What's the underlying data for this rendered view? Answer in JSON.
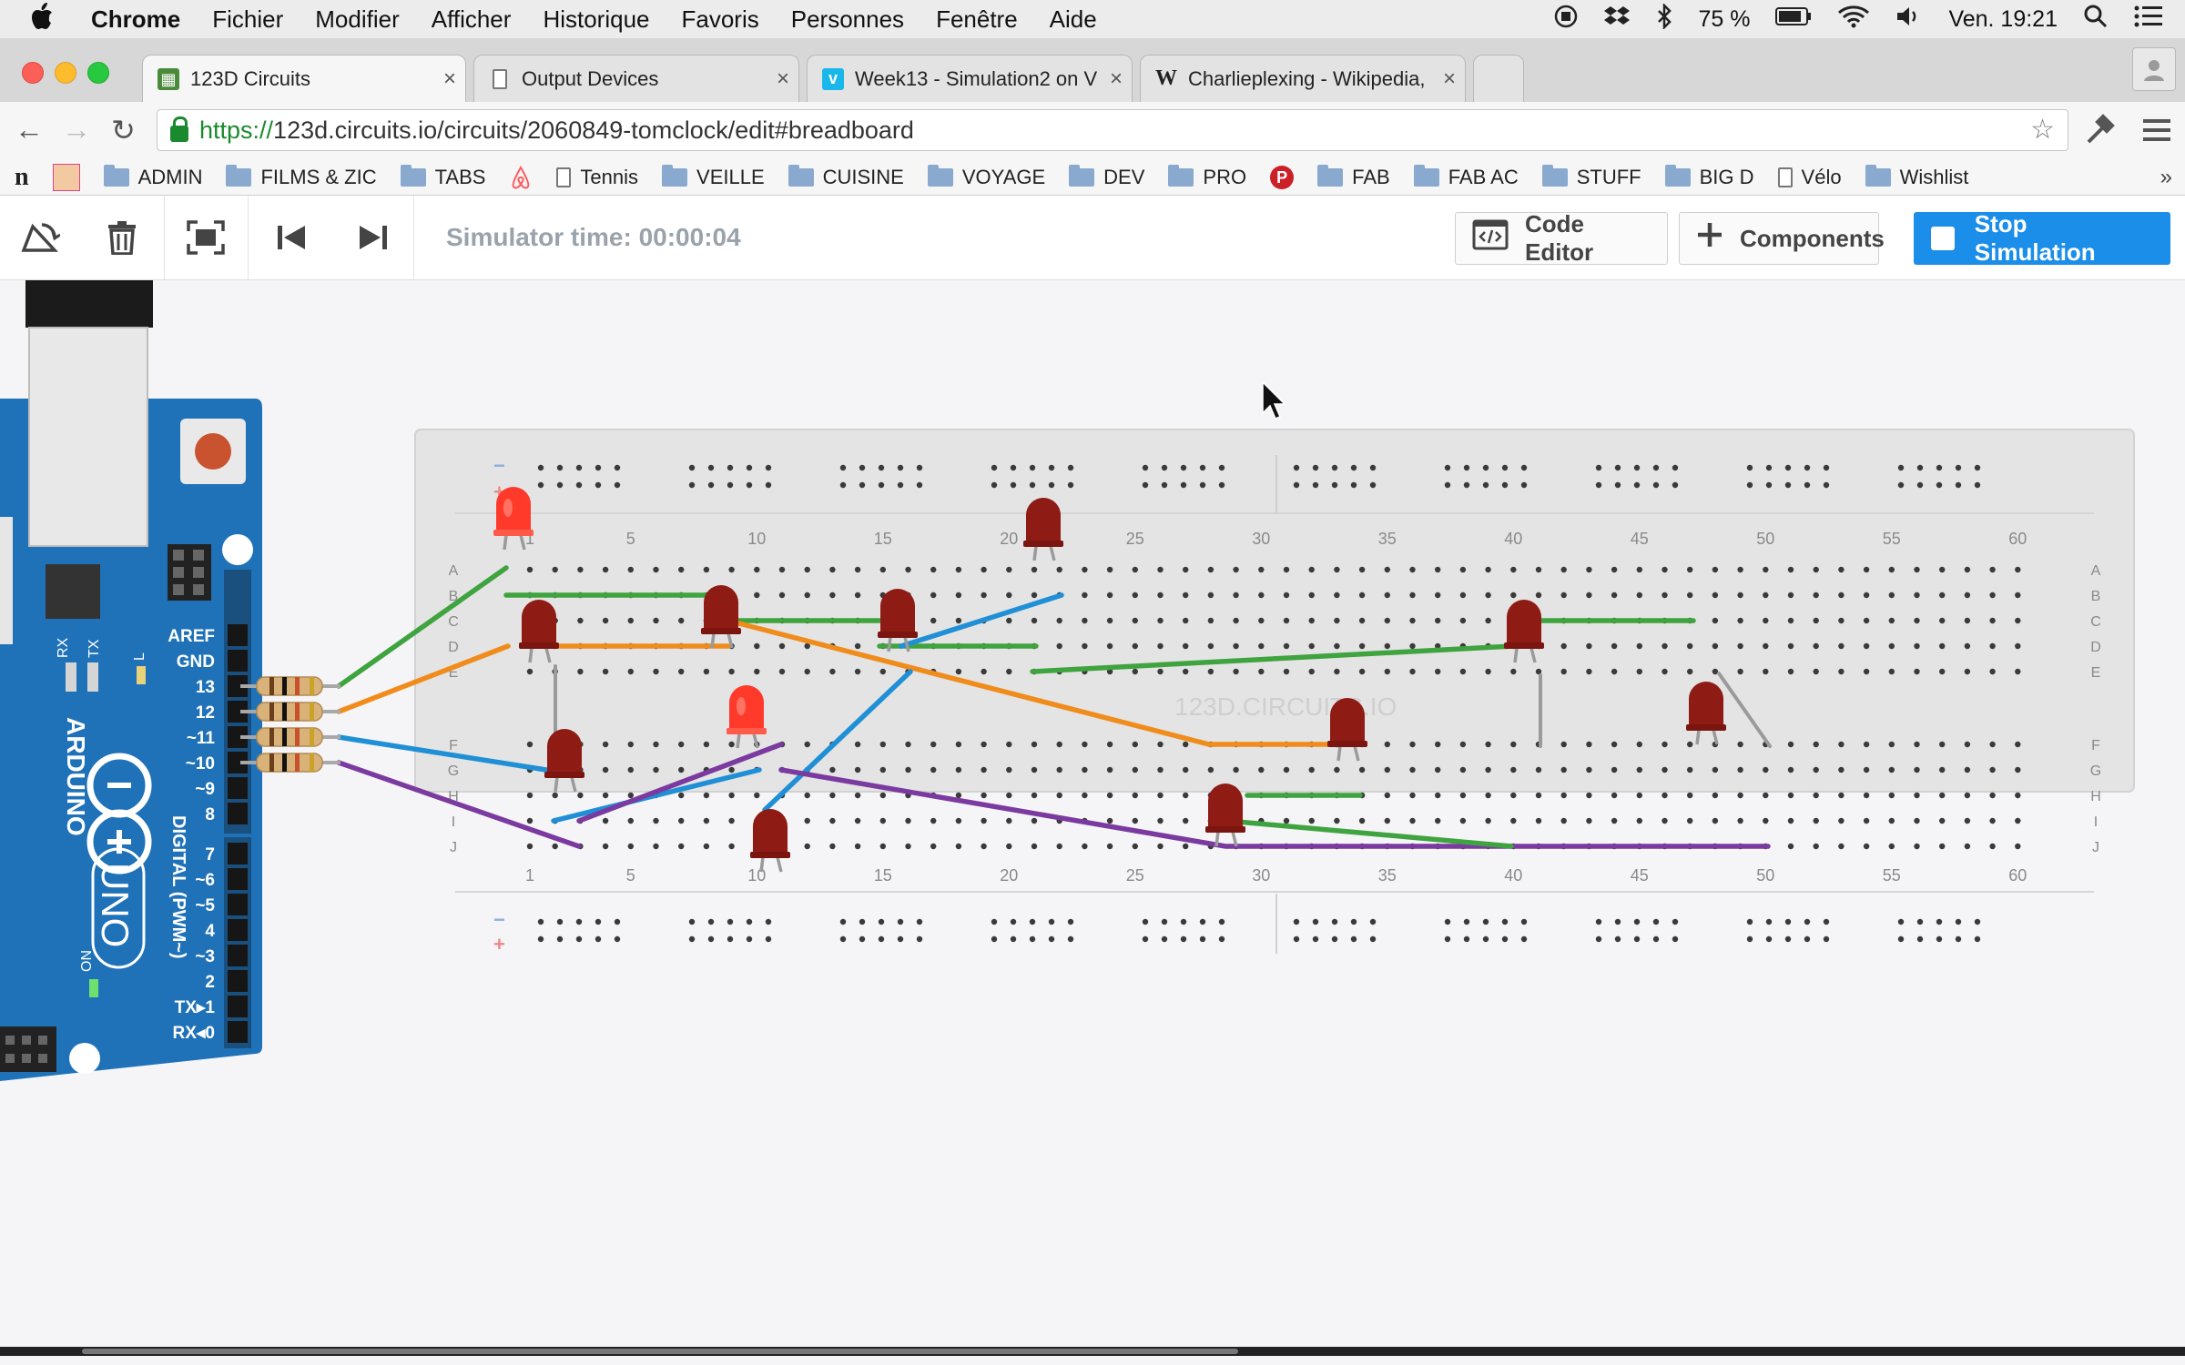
{
  "menubar": {
    "app": "Chrome",
    "items": [
      "Fichier",
      "Modifier",
      "Afficher",
      "Historique",
      "Favoris",
      "Personnes",
      "Fenêtre",
      "Aide"
    ],
    "battery": "75 %",
    "clock": "Ven. 19:21"
  },
  "tabs": [
    {
      "title": "123D Circuits",
      "icon": "123d-favicon",
      "active": true
    },
    {
      "title": "Output Devices",
      "icon": "document-icon",
      "active": false
    },
    {
      "title": "Week13 - Simulation2 on V",
      "icon": "vimeo-favicon",
      "active": false
    },
    {
      "title": "Charlieplexing - Wikipedia,",
      "icon": "wikipedia-favicon",
      "active": false
    }
  ],
  "address": {
    "scheme": "https://",
    "rest": "123d.circuits.io/circuits/2060849-tomclock/edit#breadboard"
  },
  "bookmarks": [
    {
      "label": "",
      "type": "n-logo"
    },
    {
      "label": "",
      "type": "avatar"
    },
    {
      "label": "ADMIN",
      "type": "folder"
    },
    {
      "label": "FILMS & ZIC",
      "type": "folder"
    },
    {
      "label": "TABS",
      "type": "folder"
    },
    {
      "label": "",
      "type": "airbnb"
    },
    {
      "label": "Tennis",
      "type": "doc"
    },
    {
      "label": "VEILLE",
      "type": "folder"
    },
    {
      "label": "CUISINE",
      "type": "folder"
    },
    {
      "label": "VOYAGE",
      "type": "folder"
    },
    {
      "label": "DEV",
      "type": "folder"
    },
    {
      "label": "PRO",
      "type": "folder"
    },
    {
      "label": "",
      "type": "pinterest"
    },
    {
      "label": "FAB",
      "type": "folder"
    },
    {
      "label": "FAB AC",
      "type": "folder"
    },
    {
      "label": "STUFF",
      "type": "folder"
    },
    {
      "label": "BIG D",
      "type": "folder"
    },
    {
      "label": "Vélo",
      "type": "doc"
    },
    {
      "label": "Wishlist",
      "type": "folder"
    }
  ],
  "toolbar": {
    "sim_time": "Simulator time: 00:00:04",
    "code_editor": "Code Editor",
    "components": "Components",
    "stop_simulation": "Stop Simulation"
  },
  "arduino": {
    "brand": "ARDUINO",
    "model": "UNO",
    "digital_label": "DIGITAL (PWM~)",
    "pins_top": [
      "AREF",
      "GND",
      "13",
      "12",
      "~11",
      "~10",
      "~9",
      "8"
    ],
    "pins_bottom": [
      "7",
      "~6",
      "~5",
      "4",
      "~3",
      "2",
      "TX▸1",
      "RX◂0"
    ],
    "rx": "RX",
    "tx": "TX",
    "l": "L",
    "on": "ON"
  },
  "breadboard": {
    "watermark": "123D.CIRCUITS.IO",
    "col_numbers": [
      "1",
      "5",
      "10",
      "15",
      "20",
      "25",
      "30",
      "35",
      "40",
      "45",
      "50",
      "55",
      "60"
    ],
    "rows_top": [
      "A",
      "B",
      "C",
      "D",
      "E"
    ],
    "rows_bottom": [
      "F",
      "G",
      "H",
      "I",
      "J"
    ],
    "rail_minus": "−",
    "rail_plus": "+"
  },
  "colors": {
    "arduino_blue": "#1f72b8",
    "wire_green": "#3fa33f",
    "wire_orange": "#f08c1c",
    "wire_blue": "#1f8fd6",
    "wire_purple": "#7b3aa0",
    "led_off": "#8e1b14",
    "led_on": "#ff3a2a",
    "accent": "#1a8ee8"
  }
}
